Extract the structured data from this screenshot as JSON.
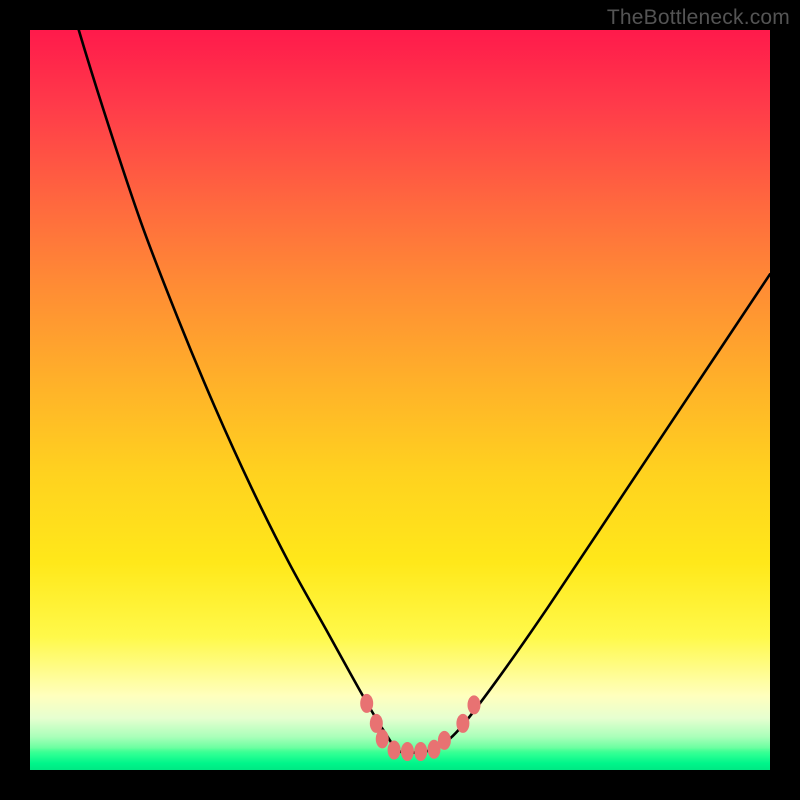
{
  "watermark": "TheBottleneck.com",
  "colors": {
    "frame": "#000000",
    "curve": "#000000",
    "markers": "#e87272",
    "gradient_top": "#ff1a4b",
    "gradient_bottom": "#00ff88"
  },
  "chart_data": {
    "type": "line",
    "title": "",
    "xlabel": "",
    "ylabel": "",
    "xlim": [
      0,
      100
    ],
    "ylim": [
      0,
      100
    ],
    "note": "No numeric axis ticks are visible; x and values are estimated as relative percentages of the plot area. 0 = bottom/left, 100 = top/right.",
    "series": [
      {
        "name": "curve",
        "x": [
          0,
          3,
          6,
          10,
          15,
          20,
          25,
          30,
          35,
          40,
          45,
          48,
          50,
          53,
          55,
          58,
          63,
          70,
          80,
          90,
          100
        ],
        "values": [
          124,
          113,
          102,
          89,
          74,
          61,
          49,
          38,
          28,
          19,
          10,
          5,
          2.5,
          2.5,
          3,
          5.5,
          12,
          22,
          37,
          52,
          67
        ]
      }
    ],
    "markers": [
      {
        "series": "curve",
        "x": 45.5,
        "value": 9.0
      },
      {
        "series": "curve",
        "x": 46.8,
        "value": 6.3
      },
      {
        "series": "curve",
        "x": 47.6,
        "value": 4.2
      },
      {
        "series": "curve",
        "x": 49.2,
        "value": 2.7
      },
      {
        "series": "curve",
        "x": 51.0,
        "value": 2.5
      },
      {
        "series": "curve",
        "x": 52.8,
        "value": 2.5
      },
      {
        "series": "curve",
        "x": 54.6,
        "value": 2.8
      },
      {
        "series": "curve",
        "x": 56.0,
        "value": 4.0
      },
      {
        "series": "curve",
        "x": 58.5,
        "value": 6.3
      },
      {
        "series": "curve",
        "x": 60.0,
        "value": 8.8
      }
    ]
  }
}
